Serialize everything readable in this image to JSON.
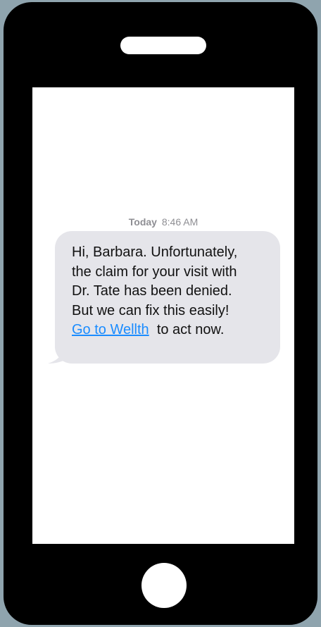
{
  "message_thread": {
    "timestamp_day": "Today",
    "timestamp_time": "8:46 AM",
    "message": {
      "line_1": "Hi, Barbara. Unfortunately,",
      "line_2": "the claim for your visit with",
      "line_3": "Dr. Tate has been denied.",
      "line_4": "But we can fix this easily!",
      "link_text": "Go to Wellth",
      "after_link": "to act now."
    }
  },
  "colors": {
    "background": "#8fa4ae",
    "phone_body": "#000000",
    "screen": "#ffffff",
    "bubble": "#e5e5ea",
    "link": "#1a8cff",
    "timestamp": "#8e8e93"
  },
  "icons": {
    "home_button": "home-button-circle",
    "speaker": "earpiece-speaker"
  }
}
